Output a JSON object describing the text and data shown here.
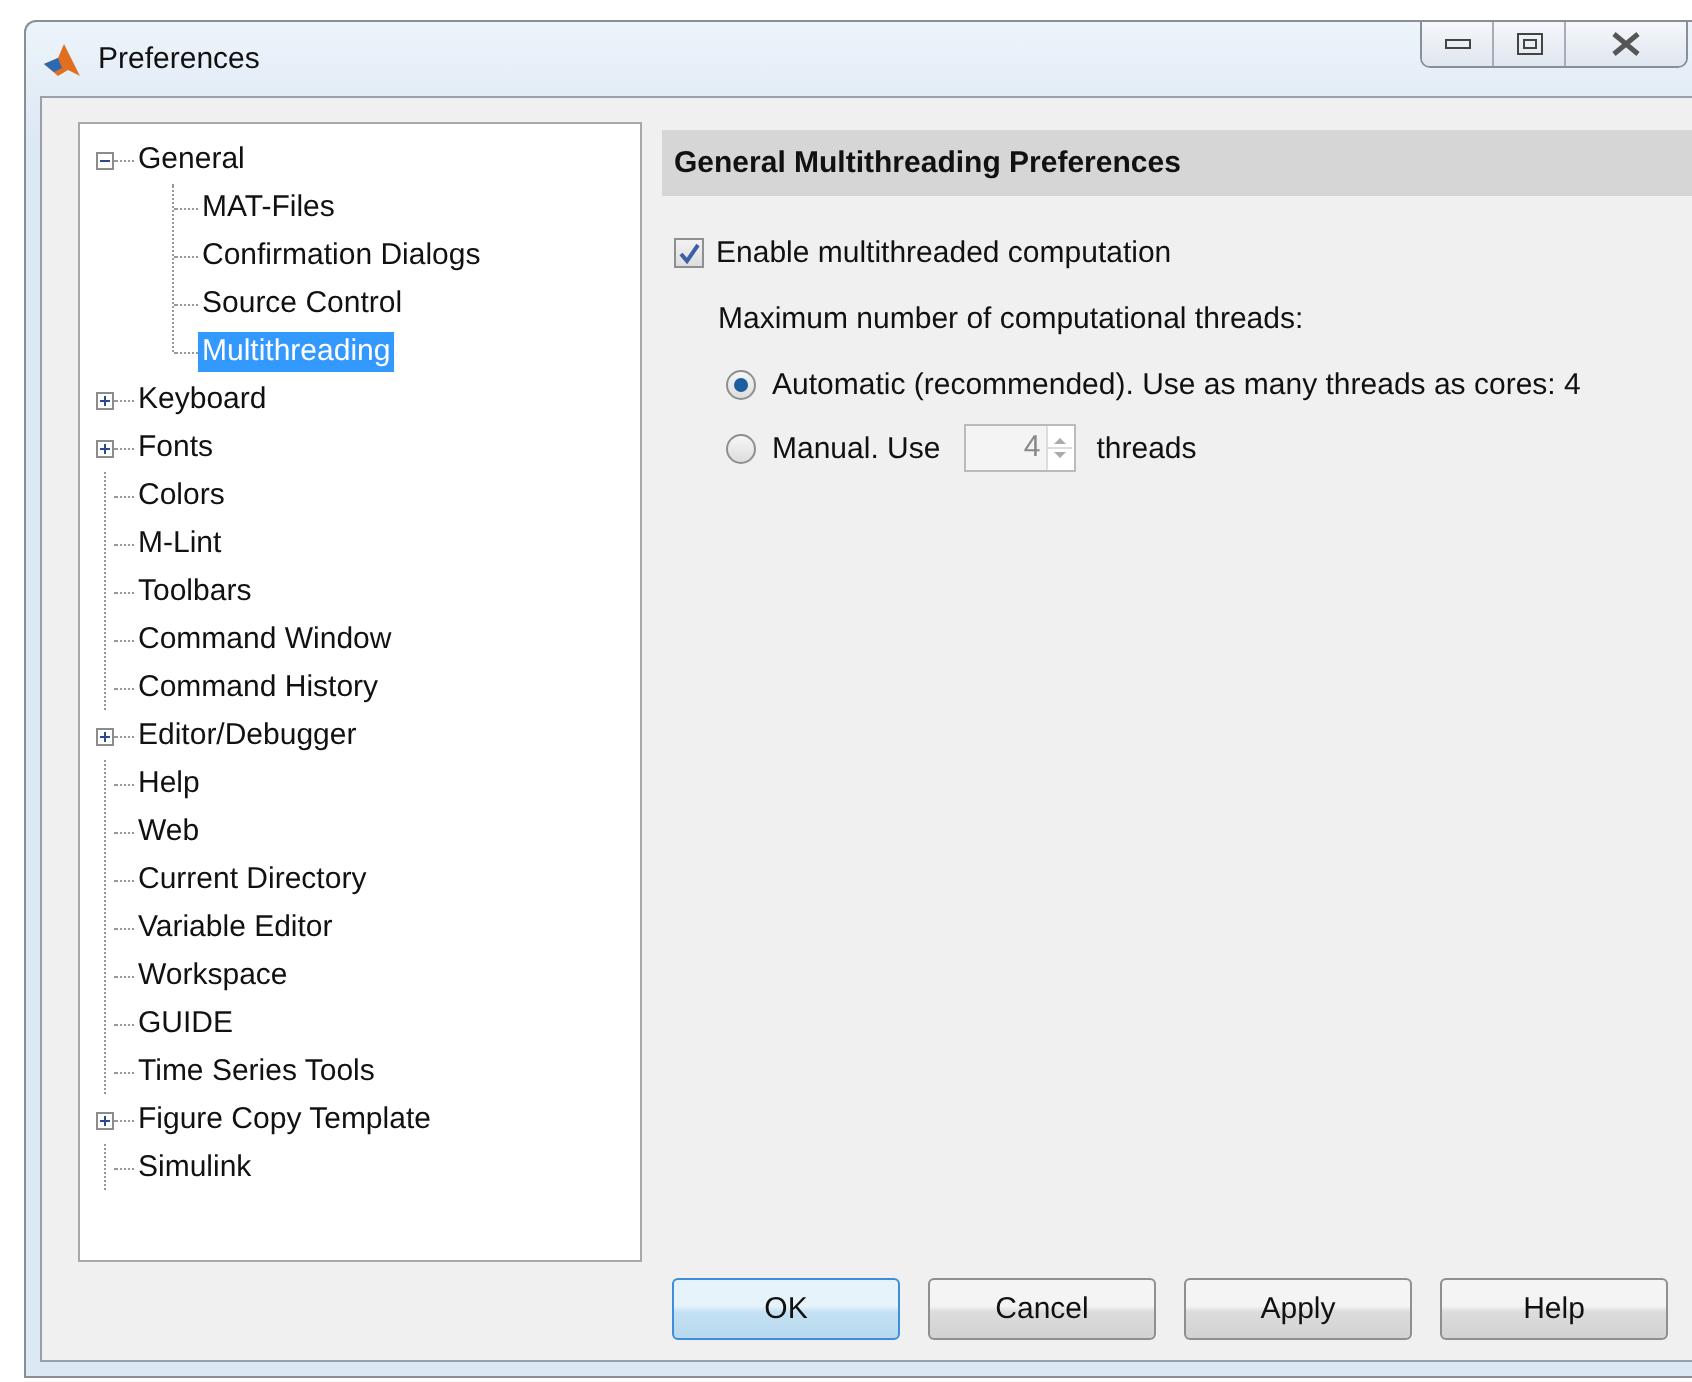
{
  "window": {
    "title": "Preferences"
  },
  "tree": [
    {
      "label": "General",
      "kind": "group",
      "expanded": true,
      "selected": false,
      "children": [
        {
          "label": "MAT-Files",
          "selected": false
        },
        {
          "label": "Confirmation Dialogs",
          "selected": false
        },
        {
          "label": "Source Control",
          "selected": false
        },
        {
          "label": "Multithreading",
          "selected": true
        }
      ]
    },
    {
      "label": "Keyboard",
      "kind": "group",
      "expanded": false,
      "selected": false
    },
    {
      "label": "Fonts",
      "kind": "group",
      "expanded": false,
      "selected": false
    },
    {
      "label": "Colors",
      "kind": "leaf",
      "selected": false
    },
    {
      "label": "M-Lint",
      "kind": "leaf",
      "selected": false
    },
    {
      "label": "Toolbars",
      "kind": "leaf",
      "selected": false
    },
    {
      "label": "Command Window",
      "kind": "leaf",
      "selected": false
    },
    {
      "label": "Command History",
      "kind": "leaf",
      "selected": false
    },
    {
      "label": "Editor/Debugger",
      "kind": "group",
      "expanded": false,
      "selected": false
    },
    {
      "label": "Help",
      "kind": "leaf",
      "selected": false
    },
    {
      "label": "Web",
      "kind": "leaf",
      "selected": false
    },
    {
      "label": "Current Directory",
      "kind": "leaf",
      "selected": false
    },
    {
      "label": "Variable Editor",
      "kind": "leaf",
      "selected": false
    },
    {
      "label": "Workspace",
      "kind": "leaf",
      "selected": false
    },
    {
      "label": "GUIDE",
      "kind": "leaf",
      "selected": false
    },
    {
      "label": "Time Series Tools",
      "kind": "leaf",
      "selected": false
    },
    {
      "label": "Figure Copy Template",
      "kind": "group",
      "expanded": false,
      "selected": false
    },
    {
      "label": "Simulink",
      "kind": "leaf",
      "selected": false
    }
  ],
  "panel": {
    "title": "General Multithreading Preferences",
    "enable": {
      "label": "Enable multithreaded computation",
      "checked": true
    },
    "prompt": "Maximum number of computational threads:",
    "options": [
      {
        "label": "Automatic (recommended). Use as many threads as cores: 4",
        "selected": true
      },
      {
        "label": "Manual. Use",
        "selected": false,
        "spinner": {
          "value": "4",
          "disabled": true
        },
        "suffix": "threads"
      }
    ]
  },
  "buttons": [
    {
      "label": "OK",
      "default": true
    },
    {
      "label": "Cancel",
      "default": false
    },
    {
      "label": "Apply",
      "default": false
    },
    {
      "label": "Help",
      "default": false
    }
  ]
}
